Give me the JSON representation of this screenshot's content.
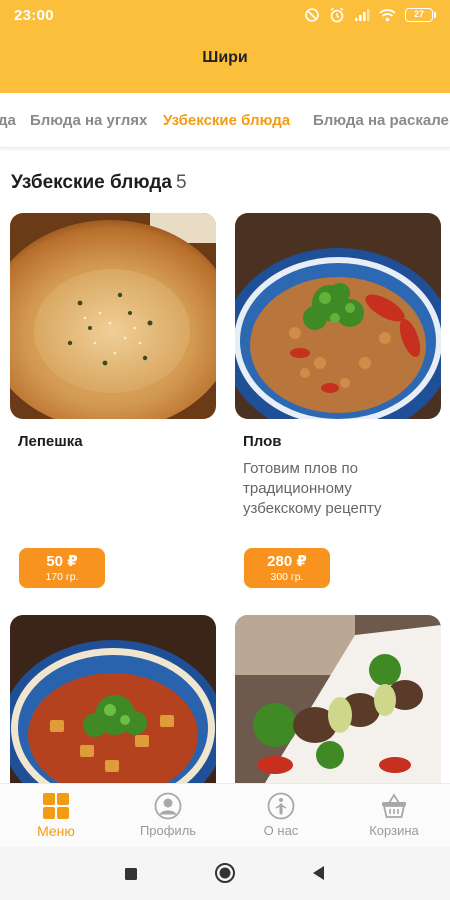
{
  "status_bar": {
    "time": "23:00",
    "battery": "27"
  },
  "header": {
    "title": "Шири"
  },
  "tabs": [
    {
      "label": "да",
      "active": false
    },
    {
      "label": "Блюда на углях",
      "active": false
    },
    {
      "label": "Узбекские блюда",
      "active": true
    },
    {
      "label": "Блюда на раскале",
      "active": false
    }
  ],
  "section": {
    "title": "Узбекские блюда",
    "count": "5"
  },
  "products": [
    {
      "name": "Лепешка",
      "description": "",
      "price": "50 ₽",
      "weight": "170 гр."
    },
    {
      "name": "Плов",
      "description": "Готовим плов по традиционному узбекскому рецепту",
      "price": "280 ₽",
      "weight": "300 гр."
    }
  ],
  "bottom_nav": [
    {
      "label": "Меню",
      "icon": "grid-icon",
      "active": true
    },
    {
      "label": "Профиль",
      "icon": "profile-icon",
      "active": false
    },
    {
      "label": "О нас",
      "icon": "info-icon",
      "active": false
    },
    {
      "label": "Корзина",
      "icon": "basket-icon",
      "active": false
    }
  ],
  "colors": {
    "header": "#fcbf3b",
    "accent": "#f39c12",
    "price_button": "#f7931e"
  }
}
